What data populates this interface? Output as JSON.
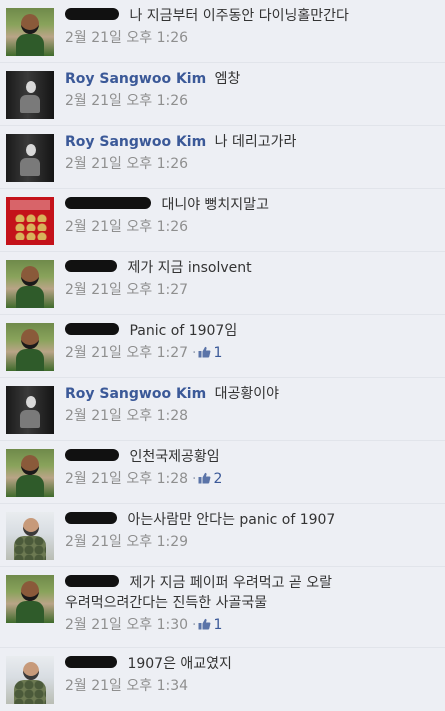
{
  "comments": [
    {
      "author": "",
      "redacted": true,
      "avatar_icon": "boy-avatar-icon",
      "text": "나 지금부터 이주동안 다이닝홀만간다",
      "time": "2월 21일 오후 1:26",
      "likes": null
    },
    {
      "author": "Roy Sangwoo Kim",
      "redacted": false,
      "avatar_icon": "dark-avatar-icon",
      "text": "엠창",
      "time": "2월 21일 오후 1:26",
      "likes": null
    },
    {
      "author": "Roy Sangwoo Kim",
      "redacted": false,
      "avatar_icon": "dark-avatar-icon",
      "text": "나 데리고가라",
      "time": "2월 21일 오후 1:26",
      "likes": null
    },
    {
      "author": "",
      "redacted": true,
      "avatar_icon": "red-avatar-icon",
      "text": "대니야 뻥치지말고",
      "time": "2월 21일 오후 1:26",
      "likes": null
    },
    {
      "author": "",
      "redacted": true,
      "avatar_icon": "boy-avatar-icon",
      "text": "제가 지금 insolvent",
      "time": "2월 21일 오후 1:27",
      "likes": null
    },
    {
      "author": "",
      "redacted": true,
      "avatar_icon": "boy-avatar-icon",
      "text": "Panic of 1907임",
      "time": "2월 21일 오후 1:27",
      "likes": "1"
    },
    {
      "author": "Roy Sangwoo Kim",
      "redacted": false,
      "avatar_icon": "dark-avatar-icon",
      "text": "대공황이야",
      "time": "2월 21일 오후 1:28",
      "likes": null
    },
    {
      "author": "",
      "redacted": true,
      "avatar_icon": "boy-avatar-icon",
      "text": "인천국제공황임",
      "time": "2월 21일 오후 1:28",
      "likes": "2"
    },
    {
      "author": "",
      "redacted": true,
      "avatar_icon": "soldier-avatar-icon",
      "text": "아는사람만 안다는 panic of 1907",
      "time": "2월 21일 오후 1:29",
      "likes": null
    },
    {
      "author": "",
      "redacted": true,
      "avatar_icon": "boy-avatar-icon",
      "text": "제가 지금 페이퍼 우려먹고 곧 오랄 우려먹으려간다는 진득한 사골국물",
      "time": "2월 21일 오후 1:30",
      "likes": "1"
    },
    {
      "author": "",
      "redacted": true,
      "avatar_icon": "soldier-avatar-icon",
      "text": "1907은 애교였지",
      "time": "2월 21일 오후 1:34",
      "likes": null
    }
  ],
  "colors": {
    "author_link": "#3b5998",
    "meta_text": "#8f8f8f",
    "background": "#edeff4"
  }
}
